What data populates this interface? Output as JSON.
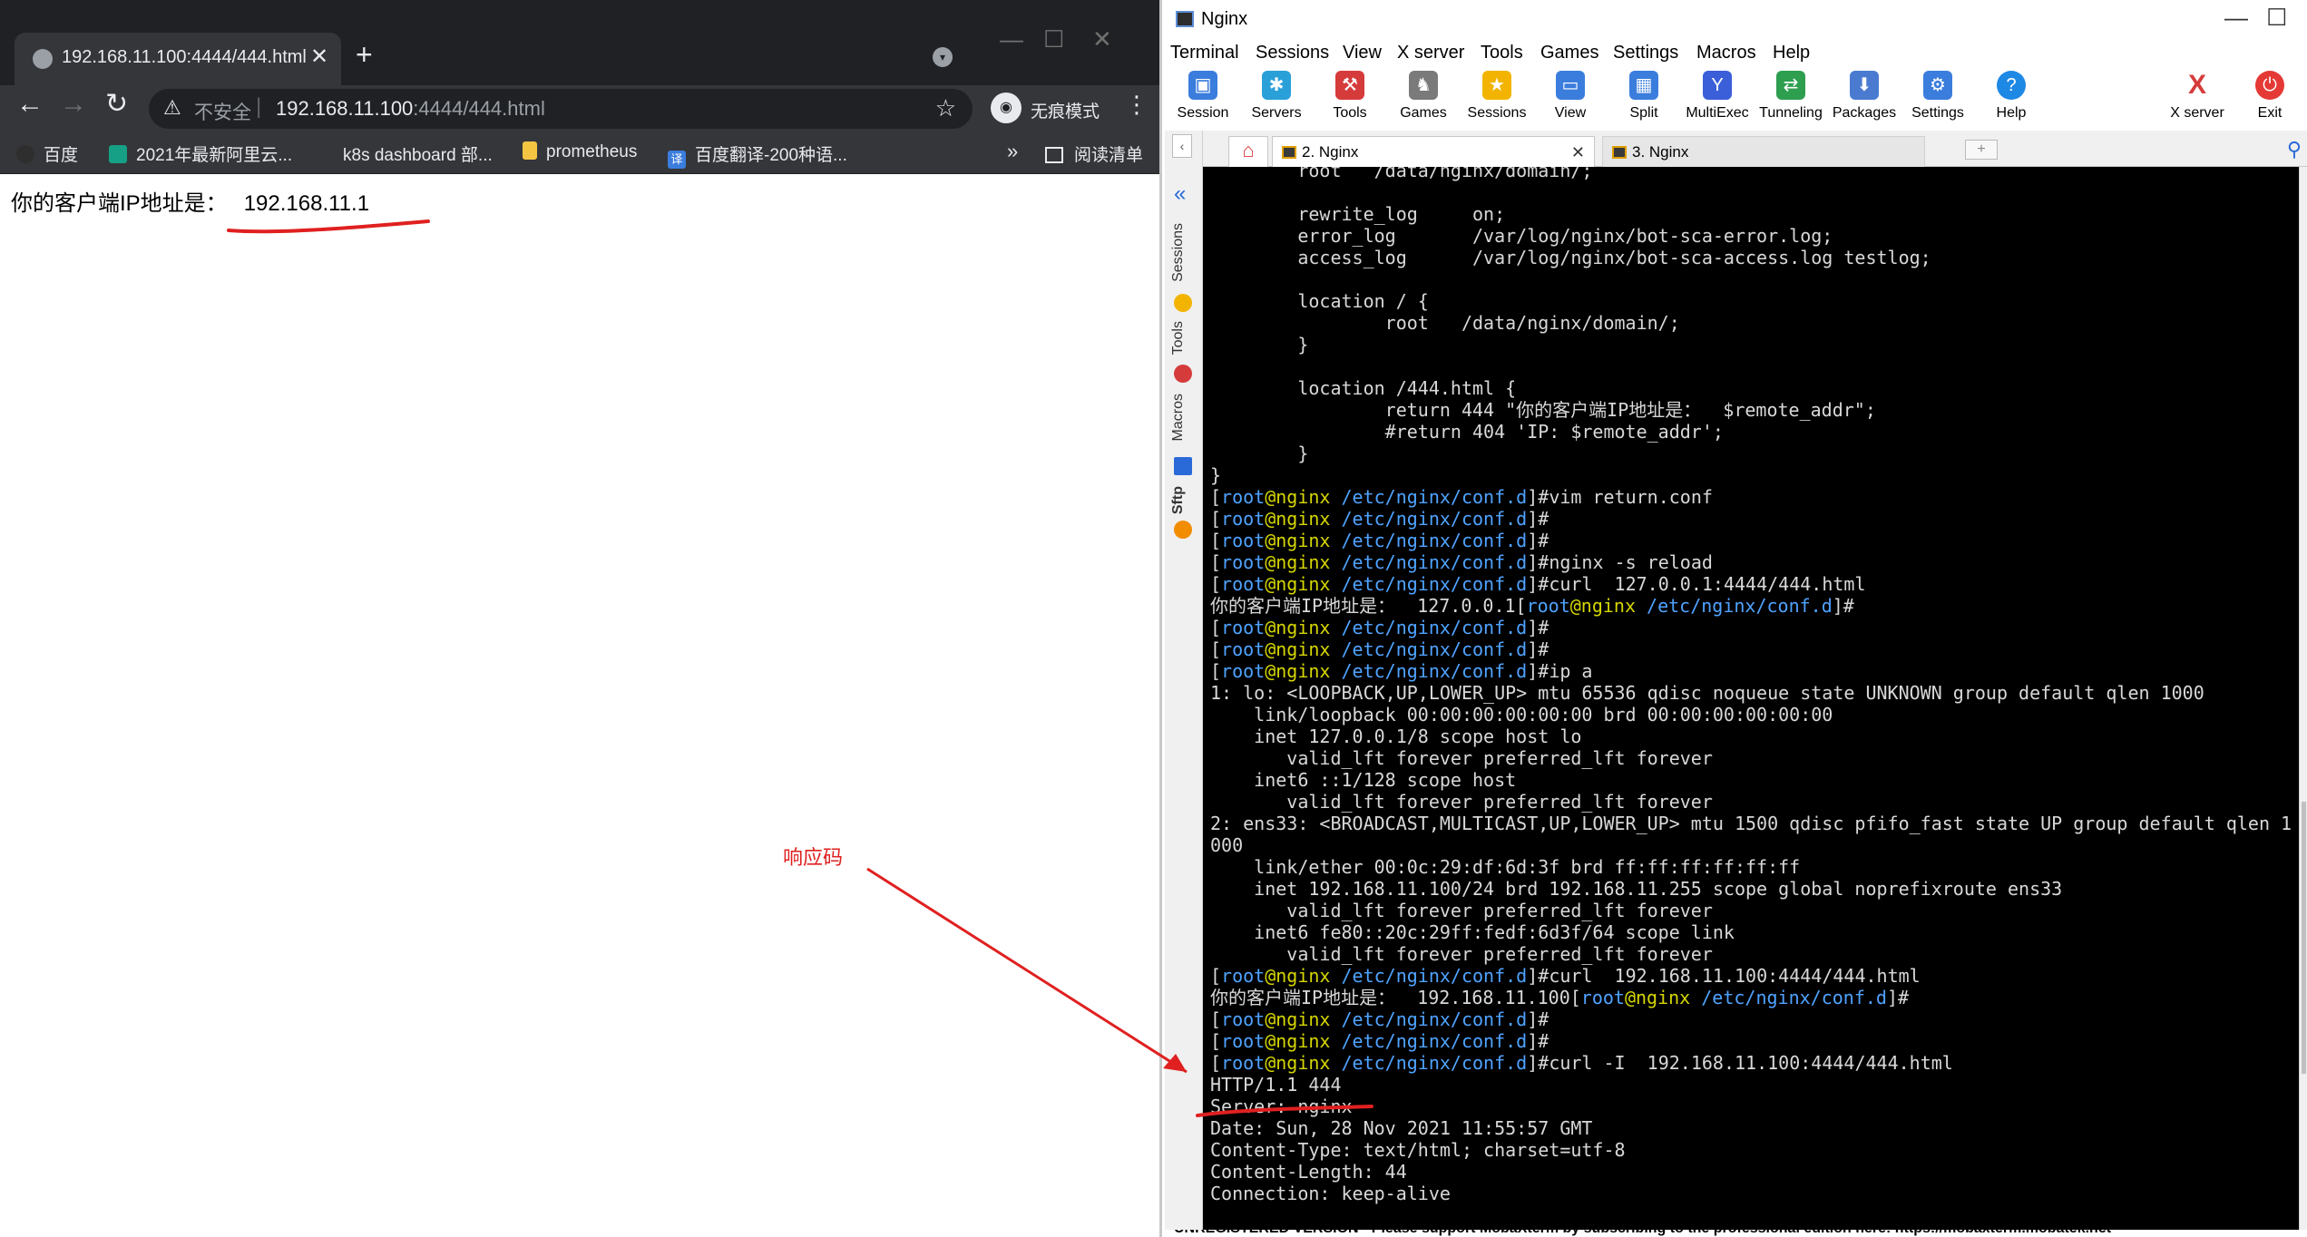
{
  "browser": {
    "tab_title": "192.168.11.100:4444/444.html",
    "not_secure": "不安全",
    "url_host": "192.168.11.100",
    "url_rest": ":4444/444.html",
    "incognito_label": "无痕模式",
    "bookmarks": [
      {
        "label": "百度",
        "icon": "baidu-icon",
        "color": "#2e2e2e"
      },
      {
        "label": "2021年最新阿里云...",
        "icon": "aliyun-icon",
        "color": "#16a085"
      },
      {
        "label": "k8s dashboard 部...",
        "icon": "page-icon",
        "color": "#35363a"
      },
      {
        "label": "prometheus",
        "icon": "folder-icon",
        "color": "#f5c542"
      },
      {
        "label": "百度翻译-200种语...",
        "icon": "translate-icon",
        "color": "#3b7ddd",
        "glyph": "译"
      }
    ],
    "bookmarks_more": "»",
    "reading_list": "阅读清单",
    "page_prefix": "你的客户端IP地址是：",
    "page_ip": "192.168.11.1"
  },
  "annotation": {
    "label": "响应码",
    "color": "#e02020"
  },
  "moba": {
    "title": "Nginx",
    "menu": [
      "Terminal",
      "Sessions",
      "View",
      "X server",
      "Tools",
      "Games",
      "Settings",
      "Macros",
      "Help"
    ],
    "toolbar": [
      {
        "label": "Session",
        "icon": "session-icon",
        "color": "#3b7ddd",
        "glyph": "▣"
      },
      {
        "label": "Servers",
        "icon": "servers-icon",
        "color": "#2aa0d8",
        "glyph": "✱"
      },
      {
        "label": "Tools",
        "icon": "tools-icon",
        "color": "#d63b3b",
        "glyph": "⚒"
      },
      {
        "label": "Games",
        "icon": "games-icon",
        "color": "#7a7a7a",
        "glyph": "♞"
      },
      {
        "label": "Sessions",
        "icon": "sessions-star-icon",
        "color": "#f2b400",
        "glyph": "★"
      },
      {
        "label": "View",
        "icon": "view-icon",
        "color": "#3b7ddd",
        "glyph": "▭"
      },
      {
        "label": "Split",
        "icon": "split-icon",
        "color": "#3b7ddd",
        "glyph": "▦"
      },
      {
        "label": "MultiExec",
        "icon": "multiexec-icon",
        "color": "#3b5fd8",
        "glyph": "Y"
      },
      {
        "label": "Tunneling",
        "icon": "tunneling-icon",
        "color": "#2e9e4f",
        "glyph": "⇄"
      },
      {
        "label": "Packages",
        "icon": "packages-icon",
        "color": "#4a7bd0",
        "glyph": "⬇"
      },
      {
        "label": "Settings",
        "icon": "settings-icon",
        "color": "#3b7ddd",
        "glyph": "⚙"
      },
      {
        "label": "Help",
        "icon": "help-icon",
        "color": "#1e88e5",
        "glyph": "?"
      }
    ],
    "xserver_label": "X server",
    "exit_label": "Exit",
    "sidebar_tabs": [
      "Sessions",
      "Tools",
      "Macros",
      "Sftp"
    ],
    "tabs": [
      "2. Nginx",
      "3. Nginx"
    ],
    "status_text": "UNREGISTERED VERSION    -  Please support MobaXterm by subscribing to the professional edition here:  https://mobaxterm.mobatek.net"
  },
  "terminal": {
    "lines": [
      "        root   /data/nginx/domain/;",
      "",
      "        rewrite_log     on;",
      "        error_log       /var/log/nginx/bot-sca-error.log;",
      "        access_log      /var/log/nginx/bot-sca-access.log testlog;",
      "",
      "        location / {",
      "                root   /data/nginx/domain/;",
      "        }",
      "",
      "        location /444.html {",
      "                return 444 \"你的客户端IP地址是：  $remote_addr\";",
      "                #return 404 'IP: $remote_addr';",
      "        }",
      "}",
      {
        "prompt": true,
        "cmd": "vim return.conf"
      },
      {
        "prompt": true,
        "cmd": ""
      },
      {
        "prompt": true,
        "cmd": ""
      },
      {
        "prompt": true,
        "cmd": "nginx -s reload"
      },
      {
        "prompt": true,
        "cmd": "curl  127.0.0.1:4444/444.html"
      },
      {
        "prefix": "你的客户端IP地址是：  127.0.0.1",
        "prompt": true,
        "cmd": ""
      },
      {
        "prompt": true,
        "cmd": ""
      },
      {
        "prompt": true,
        "cmd": ""
      },
      {
        "prompt": true,
        "cmd": "ip a"
      },
      "1: lo: <LOOPBACK,UP,LOWER_UP> mtu 65536 qdisc noqueue state UNKNOWN group default qlen 1000",
      "    link/loopback 00:00:00:00:00:00 brd 00:00:00:00:00:00",
      "    inet 127.0.0.1/8 scope host lo",
      "       valid_lft forever preferred_lft forever",
      "    inet6 ::1/128 scope host",
      "       valid_lft forever preferred_lft forever",
      "2: ens33: <BROADCAST,MULTICAST,UP,LOWER_UP> mtu 1500 qdisc pfifo_fast state UP group default qlen 1",
      "000",
      "    link/ether 00:0c:29:df:6d:3f brd ff:ff:ff:ff:ff:ff",
      "    inet 192.168.11.100/24 brd 192.168.11.255 scope global noprefixroute ens33",
      "       valid_lft forever preferred_lft forever",
      "    inet6 fe80::20c:29ff:fedf:6d3f/64 scope link",
      "       valid_lft forever preferred_lft forever",
      {
        "prompt": true,
        "cmd": "curl  192.168.11.100:4444/444.html"
      },
      {
        "prefix": "你的客户端IP地址是：  192.168.11.100",
        "prompt": true,
        "cmd": ""
      },
      {
        "prompt": true,
        "cmd": ""
      },
      {
        "prompt": true,
        "cmd": ""
      },
      {
        "prompt": true,
        "cmd": "curl -I  192.168.11.100:4444/444.html"
      },
      "HTTP/1.1 444",
      "Server: nginx",
      "Date: Sun, 28 Nov 2021 11:55:57 GMT",
      "Content-Type: text/html; charset=utf-8",
      "Content-Length: 44",
      "Connection: keep-alive"
    ],
    "prompt": {
      "user": "root",
      "at": "@",
      "host": "nginx",
      "dir": "/etc/nginx/conf.d",
      "symbol": "#"
    }
  }
}
